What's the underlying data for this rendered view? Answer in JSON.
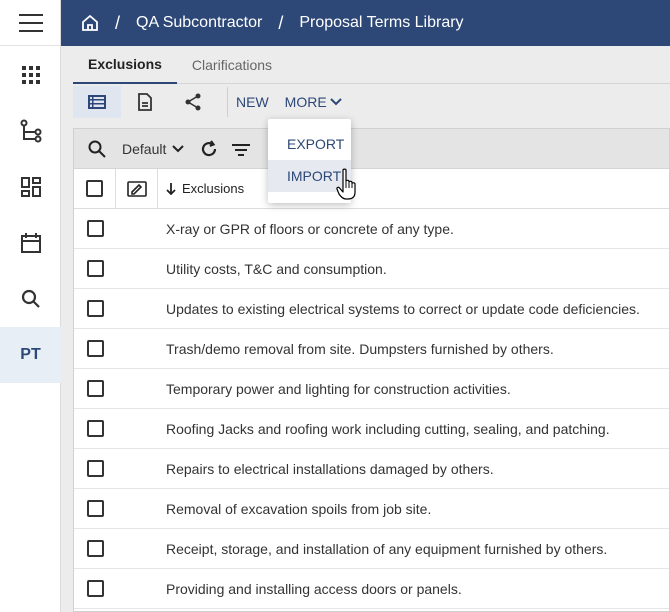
{
  "header": {
    "breadcrumb": [
      "QA Subcontractor",
      "Proposal Terms Library"
    ],
    "separator": "/"
  },
  "rail": {
    "user_initials": "PT"
  },
  "tabs": [
    {
      "label": "Exclusions",
      "active": true
    },
    {
      "label": "Clarifications",
      "active": false
    }
  ],
  "toolbar": {
    "new_label": "NEW",
    "more_label": "MORE"
  },
  "more_menu": {
    "items": [
      "EXPORT",
      "IMPORT"
    ],
    "hovered": "IMPORT"
  },
  "filter": {
    "view_label": "Default"
  },
  "table": {
    "column_header": "Exclusions",
    "sort": "descending",
    "rows": [
      "X-ray or GPR of floors or concrete of any type.",
      "Utility costs, T&C and consumption.",
      "Updates to existing electrical systems to correct or update code deficiencies.",
      "Trash/demo removal from site.  Dumpsters furnished by others.",
      "Temporary power and lighting for construction activities.",
      "Roofing Jacks and roofing work including cutting, sealing, and patching.",
      "Repairs to electrical installations damaged by others.",
      "Removal of excavation spoils from job site.",
      "Receipt, storage, and installation of any equipment furnished by others.",
      "Providing and installing access doors or panels."
    ]
  },
  "colors": {
    "header_bg": "#2d4877",
    "accent": "#2d4877",
    "active_rail": "#e8eef5"
  }
}
